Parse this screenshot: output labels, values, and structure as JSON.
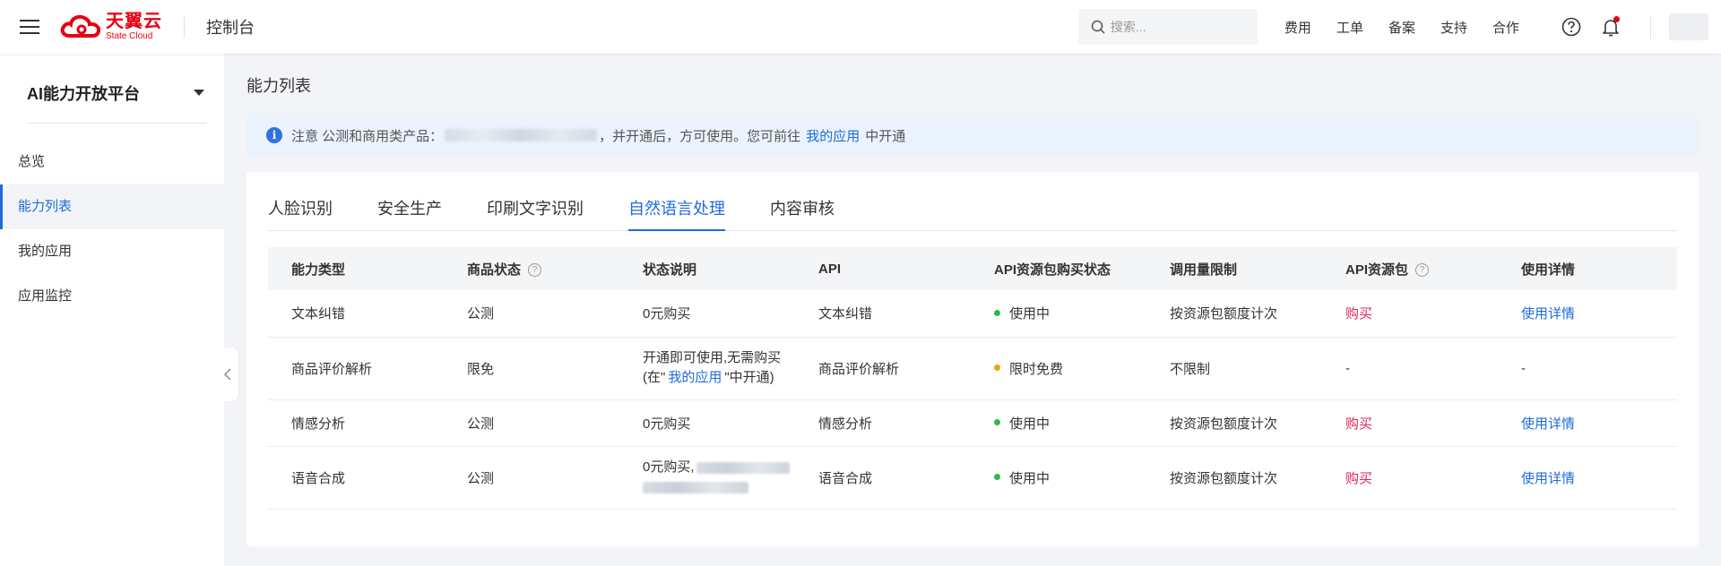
{
  "header": {
    "logo_cn": "天翼云",
    "logo_en": "State Cloud",
    "console_title": "控制台",
    "search_placeholder": "搜索...",
    "nav": [
      "费用",
      "工单",
      "备案",
      "支持",
      "合作"
    ]
  },
  "sidebar": {
    "platform_title": "AI能力开放平台",
    "items": [
      {
        "label": "总览"
      },
      {
        "label": "能力列表"
      },
      {
        "label": "我的应用"
      },
      {
        "label": "应用监控"
      }
    ]
  },
  "main": {
    "page_title": "能力列表",
    "notice": {
      "prefix": "注意 公测和商用类产品：",
      "middle": "，并开通后，方可使用。您可前往",
      "link": "我的应用",
      "suffix": "中开通"
    },
    "tabs": [
      "人脸识别",
      "安全生产",
      "印刷文字识别",
      "自然语言处理",
      "内容审核"
    ],
    "table": {
      "headers": [
        "能力类型",
        "商品状态",
        "状态说明",
        "API",
        "API资源包购买状态",
        "调用量限制",
        "API资源包",
        "使用详情"
      ],
      "rows": [
        {
          "type": "文本纠错",
          "status": "公测",
          "desc": "0元购买",
          "api": "文本纠错",
          "buy_status": "使用中",
          "limit": "按资源包额度计次",
          "pkg": "购买",
          "detail": "使用详情"
        },
        {
          "type": "商品评价解析",
          "status": "限免",
          "desc_line1": "开通即可使用,无需购买",
          "desc_line2_prefix": "(在\"",
          "desc_line2_link": "我的应用",
          "desc_line2_suffix": "\"中开通)",
          "api": "商品评价解析",
          "buy_status": "限时免费",
          "limit": "不限制",
          "pkg": "-",
          "detail": "-"
        },
        {
          "type": "情感分析",
          "status": "公测",
          "desc": "0元购买",
          "api": "情感分析",
          "buy_status": "使用中",
          "limit": "按资源包额度计次",
          "pkg": "购买",
          "detail": "使用详情"
        },
        {
          "type": "语音合成",
          "status": "公测",
          "desc": "0元购买,",
          "api": "语音合成",
          "buy_status": "使用中",
          "limit": "按资源包额度计次",
          "pkg": "购买",
          "detail": "使用详情"
        }
      ]
    }
  },
  "colors": {
    "accent": "#1f6bd9",
    "brand_red": "#e60012",
    "active_dot": "#2db84d",
    "free_dot": "#f0a500",
    "buy": "#e0245a"
  }
}
